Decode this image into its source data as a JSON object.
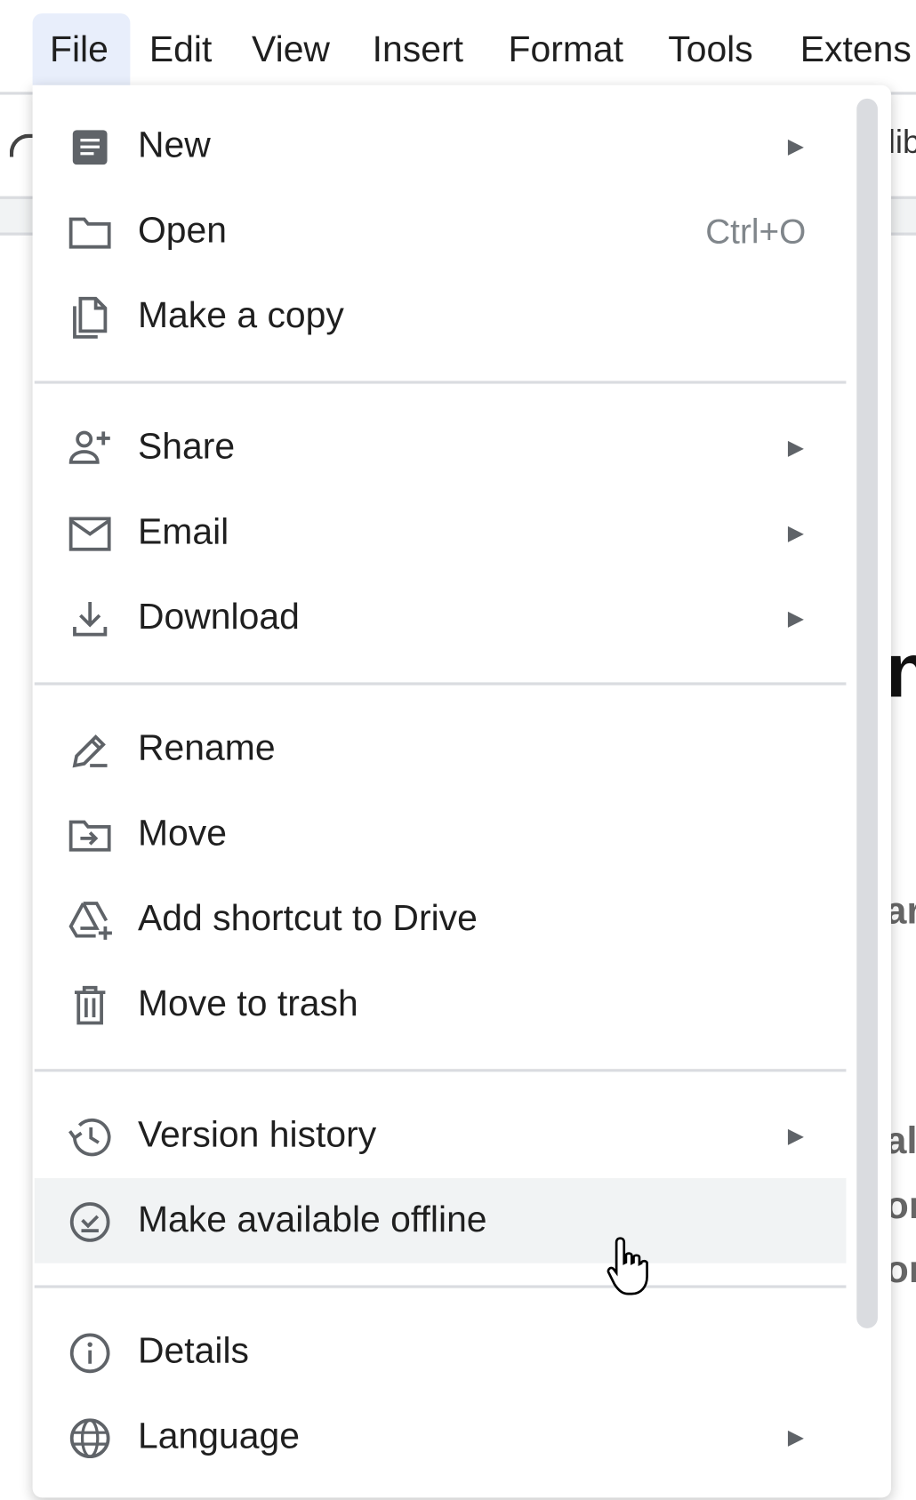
{
  "menubar": {
    "items": [
      "File",
      "Edit",
      "View",
      "Insert",
      "Format",
      "Tools",
      "Extens"
    ]
  },
  "background_fragments": [
    "lib",
    "n",
    "ar",
    "al",
    "or",
    "or"
  ],
  "file_menu": {
    "items": [
      {
        "label": "New",
        "icon": "document-icon",
        "submenu": true
      },
      {
        "label": "Open",
        "icon": "folder-icon",
        "shortcut": "Ctrl+O"
      },
      {
        "label": "Make a copy",
        "icon": "copy-icon"
      },
      {
        "label": "Share",
        "icon": "person-add-icon",
        "submenu": true
      },
      {
        "label": "Email",
        "icon": "mail-icon",
        "submenu": true
      },
      {
        "label": "Download",
        "icon": "download-icon",
        "submenu": true
      },
      {
        "label": "Rename",
        "icon": "edit-icon"
      },
      {
        "label": "Move",
        "icon": "move-folder-icon"
      },
      {
        "label": "Add shortcut to Drive",
        "icon": "drive-shortcut-icon"
      },
      {
        "label": "Move to trash",
        "icon": "trash-icon"
      },
      {
        "label": "Version history",
        "icon": "history-icon",
        "submenu": true
      },
      {
        "label": "Make available offline",
        "icon": "offline-check-icon",
        "hovered": true
      },
      {
        "label": "Details",
        "icon": "info-icon"
      },
      {
        "label": "Language",
        "icon": "globe-icon",
        "submenu": true
      }
    ],
    "submenu_arrow": "▶"
  }
}
